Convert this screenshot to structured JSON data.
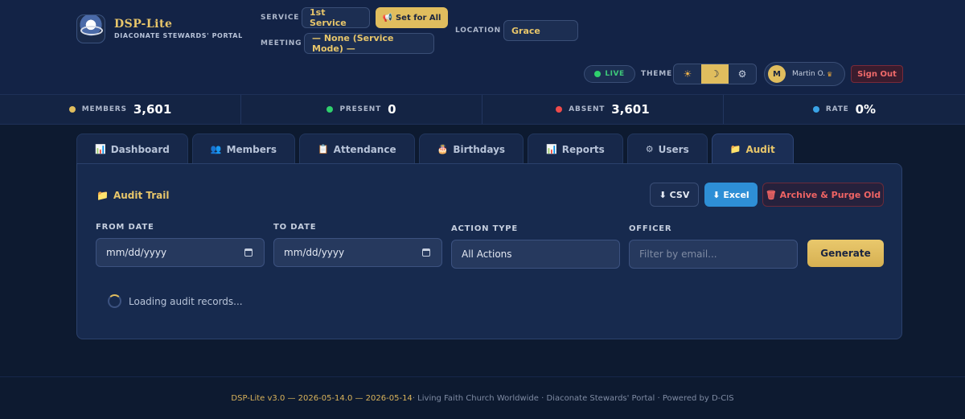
{
  "brand": {
    "title": "DSP-Lite",
    "subtitle": "DIACONATE STEWARDS' PORTAL"
  },
  "header": {
    "service_label": "SERVICE",
    "service_value": "1st Service",
    "set_all_icon": "📢",
    "set_all_label": "Set for All",
    "meeting_label": "MEETING",
    "meeting_value": "— None (Service Mode) —",
    "location_label": "LOCATION",
    "location_value": "Grace",
    "live_label": "LIVE",
    "theme_label": "THEME",
    "theme_options": [
      "☀",
      "☽",
      "⚙"
    ],
    "user_initial": "M",
    "user_name": "Martin O.",
    "user_badge": "♛",
    "signout_label": "Sign Out"
  },
  "stats": [
    {
      "label": "MEMBERS",
      "value": "3,601",
      "color": "#e0bd5e"
    },
    {
      "label": "PRESENT",
      "value": "0",
      "color": "#2fd06d"
    },
    {
      "label": "ABSENT",
      "value": "3,601",
      "color": "#ef4b4b"
    },
    {
      "label": "RATE",
      "value": "0%",
      "color": "#3aa3e6"
    }
  ],
  "tabs": [
    {
      "icon": "📊",
      "label": "Dashboard"
    },
    {
      "icon": "👥",
      "label": "Members"
    },
    {
      "icon": "📋",
      "label": "Attendance"
    },
    {
      "icon": "🎂",
      "label": "Birthdays"
    },
    {
      "icon": "📊",
      "label": "Reports"
    },
    {
      "icon": "⚙",
      "label": "Users"
    },
    {
      "icon": "📁",
      "label": "Audit",
      "active": true
    }
  ],
  "audit": {
    "title_icon": "📁",
    "title": "Audit Trail",
    "csv_label": "⬇ CSV",
    "excel_label": "⬇ Excel",
    "purge_label": "🗑 Archive & Purge Old",
    "from_label": "FROM DATE",
    "from_value": "mm/dd/yyyy",
    "to_label": "TO DATE",
    "to_value": "mm/dd/yyyy",
    "action_label": "ACTION TYPE",
    "action_value": "All Actions",
    "officer_label": "OFFICER",
    "officer_placeholder": "Filter by email...",
    "generate_label": "Generate",
    "loading_text": "Loading audit records..."
  },
  "footer": {
    "version": "DSP-Lite v3.0 — 2026-05-14.0 — 2026-05-14",
    "rest": " · Living Faith Church Worldwide · Diaconate Stewards' Portal · Powered by D-CIS"
  }
}
